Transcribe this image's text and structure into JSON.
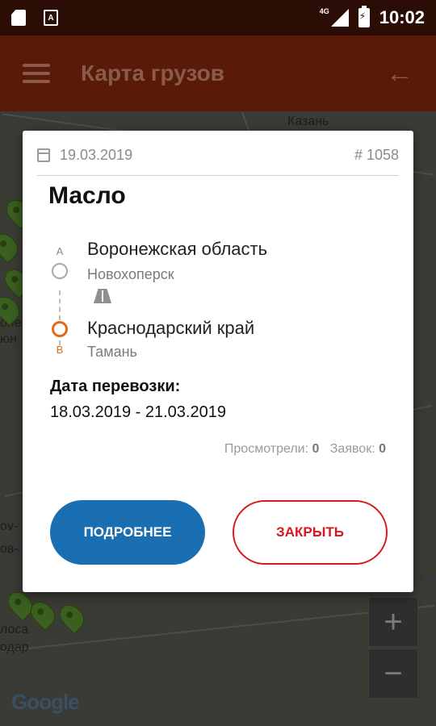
{
  "status_bar": {
    "network": "4G",
    "time": "10:02",
    "notif_icon": "A"
  },
  "app_bar": {
    "title": "Карта грузов"
  },
  "map": {
    "labels": [
      {
        "text": "Казань"
      },
      {
        "text": "опе"
      },
      {
        "text": "юн"
      },
      {
        "text": "ov-"
      },
      {
        "text": "ов-"
      },
      {
        "text": "лоса"
      },
      {
        "text": "одар"
      }
    ],
    "zoom_in": "+",
    "zoom_out": "−",
    "attribution": "Google"
  },
  "dialog": {
    "date": "19.03.2019",
    "number": "# 1058",
    "cargo": "Масло",
    "route": {
      "from": {
        "letter": "А",
        "region": "Воронежская область",
        "city": "Новохоперск"
      },
      "to": {
        "letter": "В",
        "region": "Краснодарский край",
        "city": "Тамань"
      }
    },
    "transport_date_label": "Дата перевозки:",
    "transport_date_value": "18.03.2019 - 21.03.2019",
    "views_label": "Просмотрели:",
    "views_count": "0",
    "requests_label": "Заявок:",
    "requests_count": "0",
    "more_button": "ПОДРОБНЕЕ",
    "close_button": "ЗАКРЫТЬ"
  },
  "colors": {
    "app_bar": "#5a1a08",
    "primary_button": "#1a6fb3",
    "close_button": "#d8181f",
    "point_b": "#e06a1a",
    "pin": "#3a5f1f"
  }
}
